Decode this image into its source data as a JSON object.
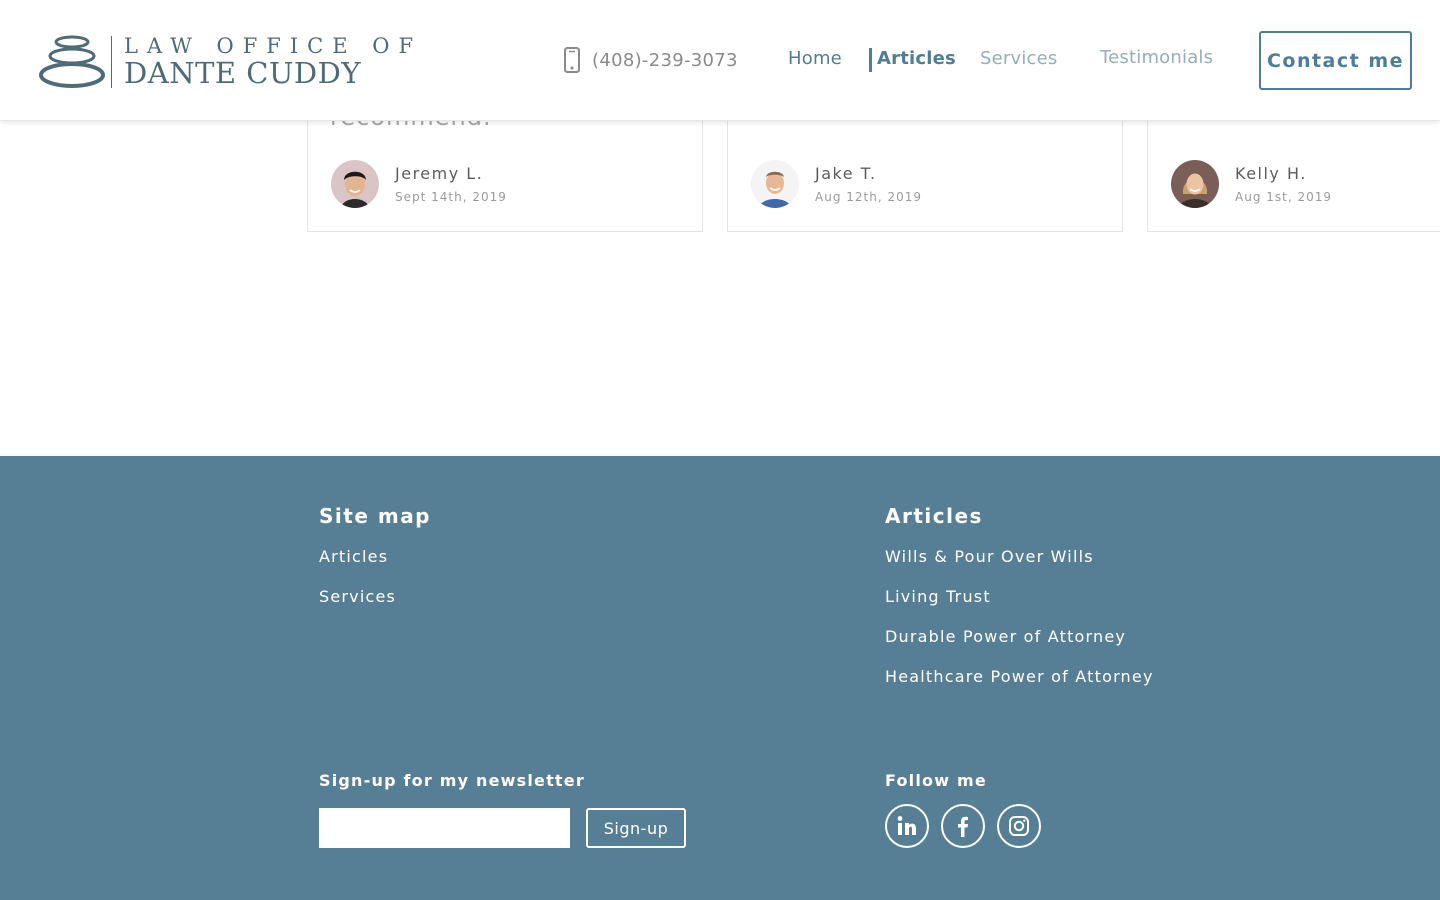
{
  "header": {
    "logo_line1": "LAW OFFICE OF",
    "logo_line2": "DANTE CUDDY",
    "phone": "(408)-239-3073",
    "nav": {
      "home": "Home",
      "articles": "Articles",
      "services": "Services",
      "testimonials": "Testimonials"
    },
    "active_nav": "Articles",
    "contact_button": "Contact me"
  },
  "testimonials": [
    {
      "quote_tail": "recommend.",
      "name": "Jeremy L.",
      "date": "Sept 14th, 2019"
    },
    {
      "quote_tail": "",
      "name": "Jake T.",
      "date": "Aug 12th, 2019"
    },
    {
      "quote_tail": "",
      "name": "Kelly H.",
      "date": "Aug 1st, 2019"
    }
  ],
  "footer": {
    "sitemap_heading": "Site map",
    "sitemap_links": [
      "Articles",
      "Services"
    ],
    "articles_heading": "Articles",
    "article_links": [
      "Wills & Pour Over Wills",
      "Living Trust",
      "Durable Power of Attorney",
      "Healthcare Power of Attorney"
    ],
    "newsletter_label": "Sign-up for my newsletter",
    "newsletter_input_value": "",
    "signup_button": "Sign-up",
    "follow_label": "Follow me",
    "social_icons": [
      "linkedin-icon",
      "facebook-icon",
      "instagram-icon"
    ]
  },
  "colors": {
    "brand": "#4f7d94",
    "brand_dark": "#4f6b78",
    "nav_inactive": "#94adba",
    "footer_bg": "#567f96"
  }
}
